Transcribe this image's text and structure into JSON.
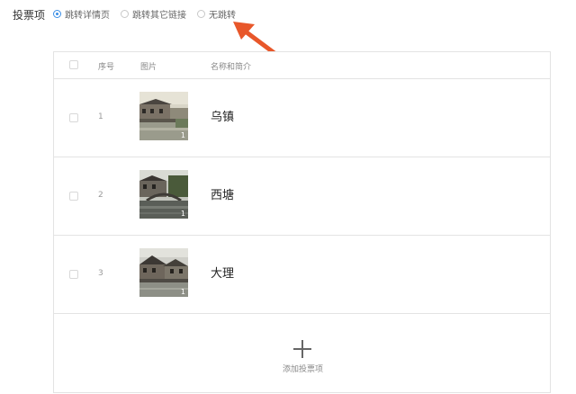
{
  "vote_items_label": "投票项",
  "radio_options": [
    {
      "label": "跳转详情页",
      "checked": true
    },
    {
      "label": "跳转其它链接",
      "checked": false
    },
    {
      "label": "无跳转",
      "checked": false
    }
  ],
  "table": {
    "headers": {
      "index": "序号",
      "image": "图片",
      "name": "名称和简介"
    },
    "rows": [
      {
        "index": "1",
        "name": "乌镇",
        "badge": "1"
      },
      {
        "index": "2",
        "name": "西塘",
        "badge": "1"
      },
      {
        "index": "3",
        "name": "大理",
        "badge": "1"
      }
    ]
  },
  "add_item_label": "添加投票项",
  "colors": {
    "accent": "#3a8ee6",
    "annotation_arrow": "#e8572a"
  }
}
